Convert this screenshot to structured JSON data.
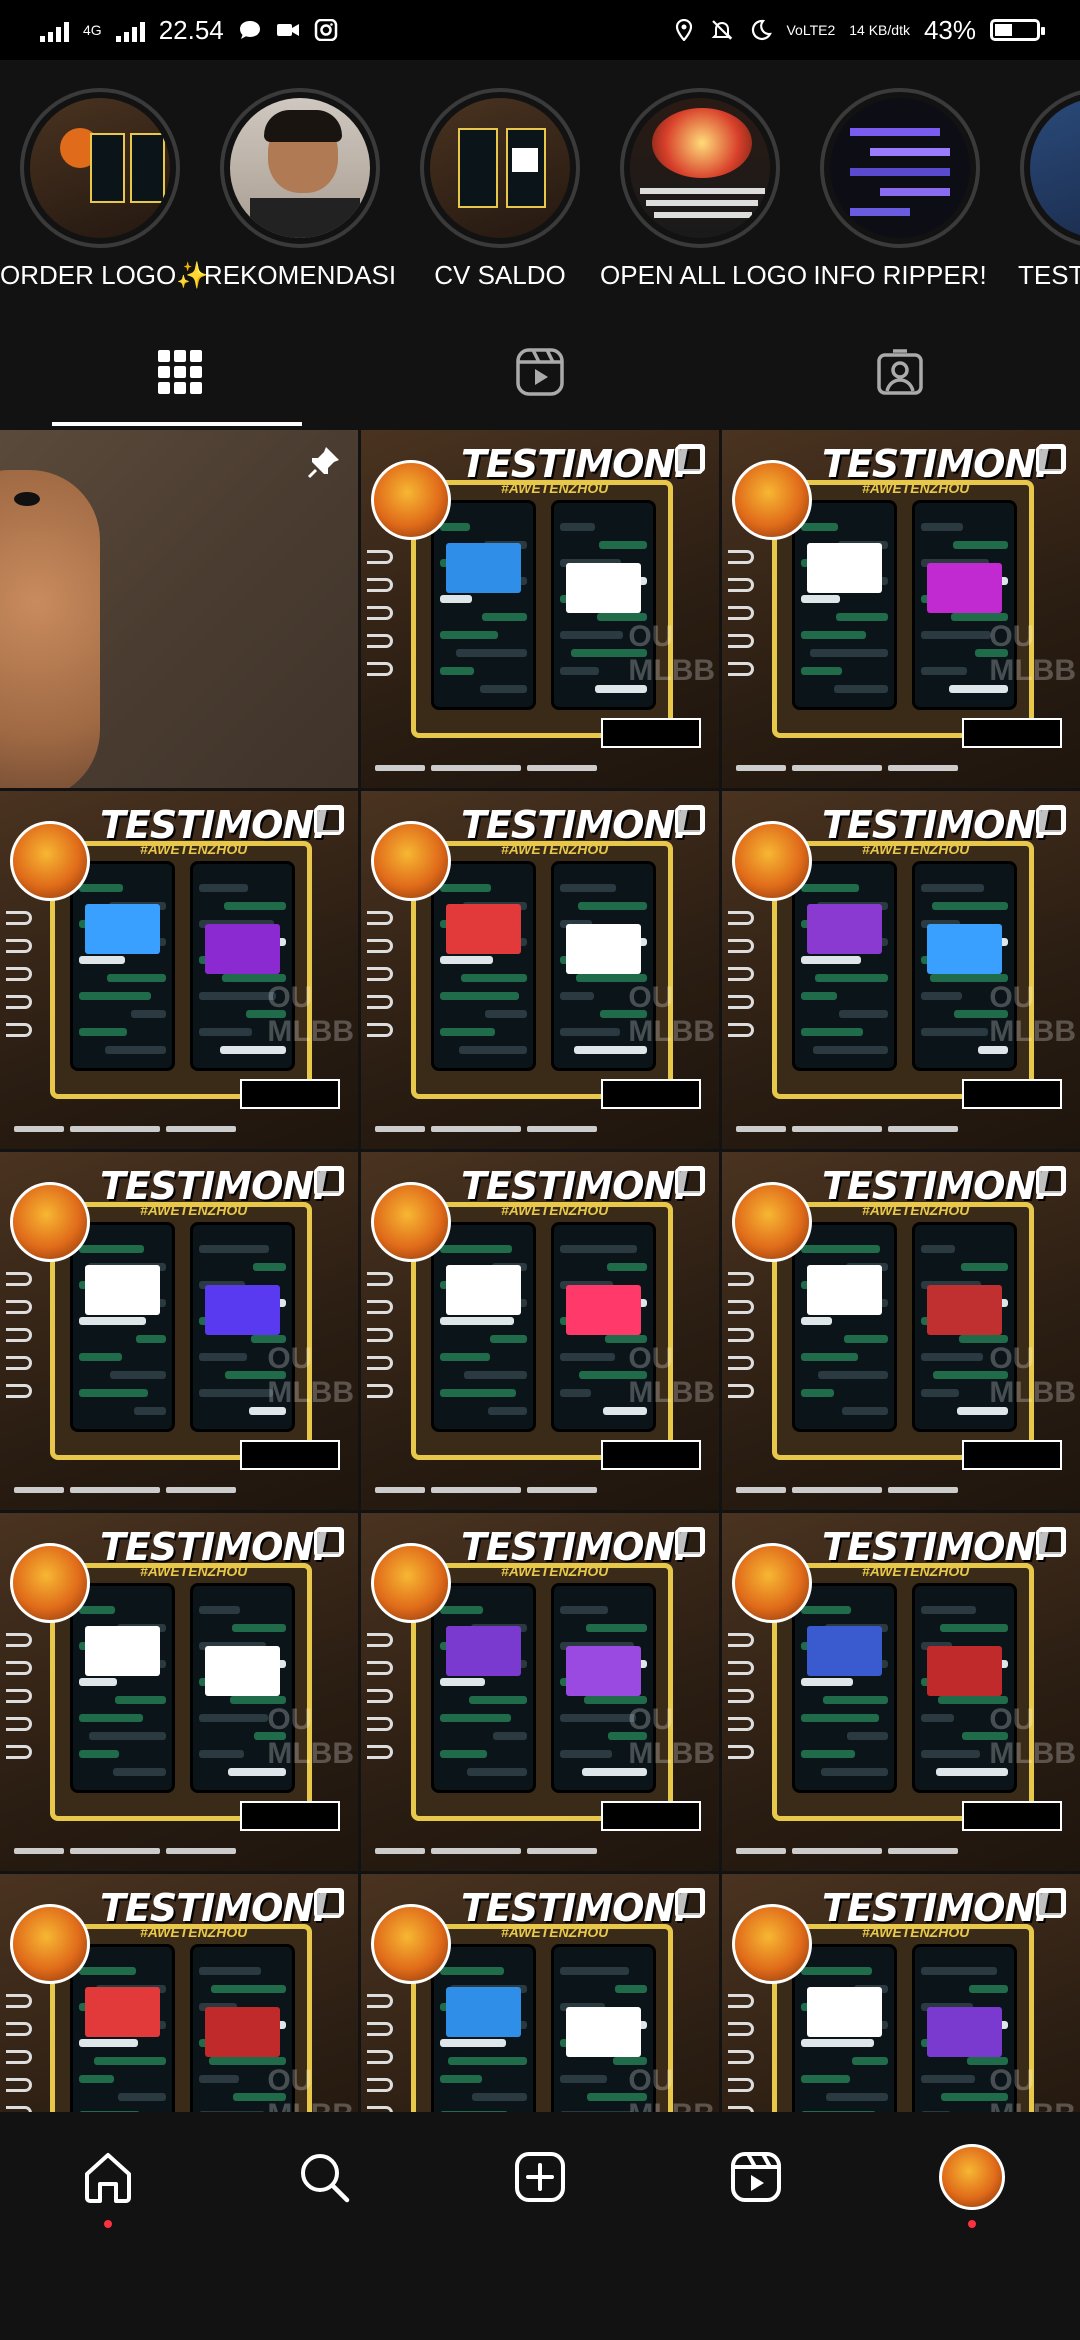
{
  "status_bar": {
    "time": "22.54",
    "network": "4G",
    "volte": "VoLTE2",
    "speed": "14 KB/dtk",
    "battery": "43%",
    "battery_level": 0.43
  },
  "highlights": [
    {
      "label": "ORDER LOGO✨"
    },
    {
      "label": "REKOMENDASI"
    },
    {
      "label": "CV SALDO"
    },
    {
      "label": "OPEN ALL LOGO"
    },
    {
      "label": "INFO RIPPER!"
    },
    {
      "label": "TESTI MLBB"
    }
  ],
  "tabs": [
    {
      "name": "posts-grid",
      "icon": "grid-icon",
      "active": true
    },
    {
      "name": "reels",
      "icon": "reels-icon",
      "active": false
    },
    {
      "name": "tagged",
      "icon": "tagged-icon",
      "active": false
    }
  ],
  "posts": {
    "testimoni_title": "TESTIMONI",
    "testimoni_sub": "#AWETENZHOU",
    "count_testimoni": 14
  },
  "bottom_nav": [
    {
      "name": "home",
      "icon": "home-icon"
    },
    {
      "name": "search",
      "icon": "search-icon"
    },
    {
      "name": "create",
      "icon": "plus-square-icon"
    },
    {
      "name": "reels",
      "icon": "reels-icon"
    },
    {
      "name": "profile",
      "icon": "profile-avatar"
    }
  ]
}
